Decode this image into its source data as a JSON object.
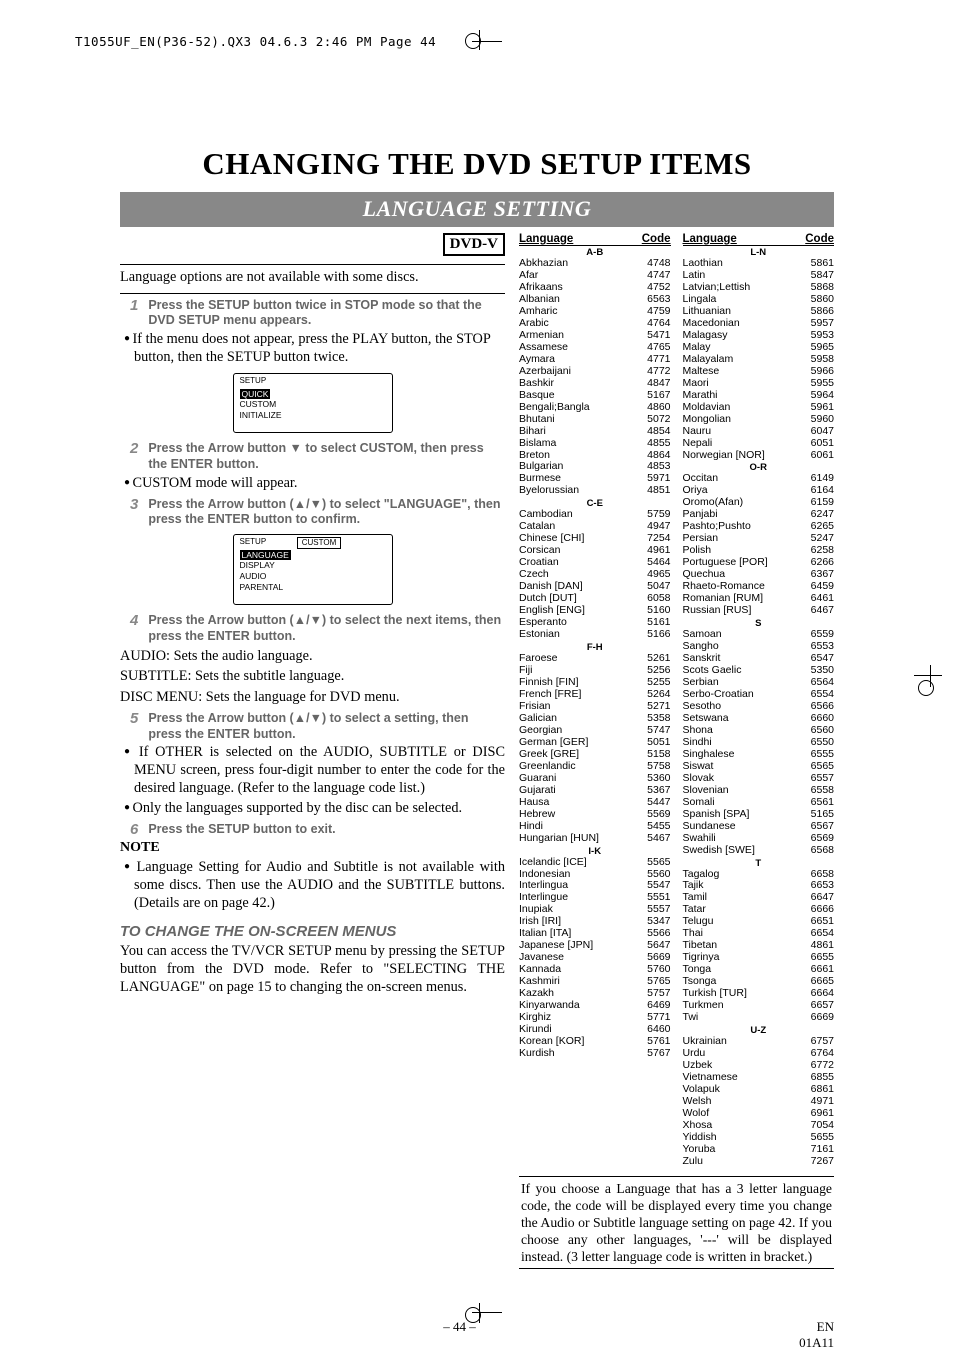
{
  "print_header": "T1055UF_EN(P36-52).QX3  04.6.3  2:46 PM  Page 44",
  "page_title": "CHANGING THE DVD SETUP ITEMS",
  "section_bar": "LANGUAGE SETTING",
  "dvd_box": "DVD-V",
  "intro": "Language options are not available with some discs.",
  "step1": "Press the SETUP button twice in STOP mode so that the DVD SETUP menu appears.",
  "bullet1": "If the menu does not appear, press the PLAY button, the STOP button, then the SETUP button twice.",
  "osd1": {
    "title": "SETUP",
    "items": [
      "QUICK",
      "CUSTOM",
      "INITIALIZE"
    ],
    "highlight": 0
  },
  "step2": "Press the Arrow button ▼ to select CUSTOM, then press the ENTER button.",
  "bullet2": "CUSTOM mode will appear.",
  "step3": "Press the Arrow button (▲/▼) to select \"LANGUAGE\", then press the ENTER button to confirm.",
  "osd2": {
    "title": "SETUP",
    "button": "CUSTOM",
    "items": [
      "LANGUAGE",
      "DISPLAY",
      "AUDIO",
      "PARENTAL"
    ],
    "highlight": 0
  },
  "step4": "Press the Arrow button (▲/▼) to select the next items, then press the ENTER button.",
  "descriptions": {
    "audio": "AUDIO: Sets the audio language.",
    "subtitle": "SUBTITLE: Sets the subtitle language.",
    "discmenu": "DISC MENU: Sets the language for DVD menu."
  },
  "step5": "Press the Arrow button (▲/▼) to select a setting, then press the ENTER button.",
  "bullet5a": "If OTHER is selected on the AUDIO, SUBTITLE or DISC MENU screen, press four-digit number to enter the code for the desired language. (Refer to the language code list.)",
  "bullet5b": "Only the languages supported by the disc can be selected.",
  "step6": "Press the SETUP button to exit.",
  "note_head": "NOTE",
  "note_bullet": "Language Setting for Audio and Subtitle is not available with some discs. Then use the AUDIO and the SUBTITLE buttons. (Details are on page 42.)",
  "subhead": "TO CHANGE THE ON-SCREEN MENUS",
  "subpara": "You can access the TV/VCR SETUP menu by pressing the SETUP button from the DVD mode. Refer to \"SELECTING THE LANGUAGE\" on page 15 to changing the on-screen menus.",
  "table_headers": {
    "lang": "Language",
    "code": "Code"
  },
  "groups_left": [
    {
      "head": "A-B",
      "items": [
        [
          "Abkhazian",
          "4748"
        ],
        [
          "Afar",
          "4747"
        ],
        [
          "Afrikaans",
          "4752"
        ],
        [
          "Albanian",
          "6563"
        ],
        [
          "Amharic",
          "4759"
        ],
        [
          "Arabic",
          "4764"
        ],
        [
          "Armenian",
          "5471"
        ],
        [
          "Assamese",
          "4765"
        ],
        [
          "Aymara",
          "4771"
        ],
        [
          "Azerbaijani",
          "4772"
        ],
        [
          "Bashkir",
          "4847"
        ],
        [
          "Basque",
          "5167"
        ],
        [
          "Bengali;Bangla",
          "4860"
        ],
        [
          "Bhutani",
          "5072"
        ],
        [
          "Bihari",
          "4854"
        ],
        [
          "Bislama",
          "4855"
        ],
        [
          "Breton",
          "4864"
        ],
        [
          "Bulgarian",
          "4853"
        ],
        [
          "Burmese",
          "5971"
        ],
        [
          "Byelorussian",
          "4851"
        ]
      ]
    },
    {
      "head": "C-E",
      "items": [
        [
          "Cambodian",
          "5759"
        ],
        [
          "Catalan",
          "4947"
        ],
        [
          "Chinese [CHI]",
          "7254"
        ],
        [
          "Corsican",
          "4961"
        ],
        [
          "Croatian",
          "5464"
        ],
        [
          "Czech",
          "4965"
        ],
        [
          "Danish [DAN]",
          "5047"
        ],
        [
          "Dutch [DUT]",
          "6058"
        ],
        [
          "English [ENG]",
          "5160"
        ],
        [
          "Esperanto",
          "5161"
        ],
        [
          "Estonian",
          "5166"
        ]
      ]
    },
    {
      "head": "F-H",
      "items": [
        [
          "Faroese",
          "5261"
        ],
        [
          "Fiji",
          "5256"
        ],
        [
          "Finnish [FIN]",
          "5255"
        ],
        [
          "French [FRE]",
          "5264"
        ],
        [
          "Frisian",
          "5271"
        ],
        [
          "Galician",
          "5358"
        ],
        [
          "Georgian",
          "5747"
        ],
        [
          "German [GER]",
          "5051"
        ],
        [
          "Greek [GRE]",
          "5158"
        ],
        [
          "Greenlandic",
          "5758"
        ],
        [
          "Guarani",
          "5360"
        ],
        [
          "Gujarati",
          "5367"
        ],
        [
          "Hausa",
          "5447"
        ],
        [
          "Hebrew",
          "5569"
        ],
        [
          "Hindi",
          "5455"
        ],
        [
          "Hungarian [HUN]",
          "5467"
        ]
      ]
    },
    {
      "head": "I-K",
      "items": [
        [
          "Icelandic [ICE]",
          "5565"
        ],
        [
          "Indonesian",
          "5560"
        ],
        [
          "Interlingua",
          "5547"
        ],
        [
          "Interlingue",
          "5551"
        ],
        [
          "Inupiak",
          "5557"
        ],
        [
          "Irish [IRI]",
          "5347"
        ],
        [
          "Italian [ITA]",
          "5566"
        ],
        [
          "Japanese [JPN]",
          "5647"
        ],
        [
          "Javanese",
          "5669"
        ],
        [
          "Kannada",
          "5760"
        ],
        [
          "Kashmiri",
          "5765"
        ],
        [
          "Kazakh",
          "5757"
        ],
        [
          "Kinyarwanda",
          "6469"
        ],
        [
          "Kirghiz",
          "5771"
        ],
        [
          "Kirundi",
          "6460"
        ],
        [
          "Korean [KOR]",
          "5761"
        ],
        [
          "Kurdish",
          "5767"
        ]
      ]
    }
  ],
  "groups_right": [
    {
      "head": "L-N",
      "items": [
        [
          "Laothian",
          "5861"
        ],
        [
          "Latin",
          "5847"
        ],
        [
          "Latvian;Lettish",
          "5868"
        ],
        [
          "Lingala",
          "5860"
        ],
        [
          "Lithuanian",
          "5866"
        ],
        [
          "Macedonian",
          "5957"
        ],
        [
          "Malagasy",
          "5953"
        ],
        [
          "Malay",
          "5965"
        ],
        [
          "Malayalam",
          "5958"
        ],
        [
          "Maltese",
          "5966"
        ],
        [
          "Maori",
          "5955"
        ],
        [
          "Marathi",
          "5964"
        ],
        [
          "Moldavian",
          "5961"
        ],
        [
          "Mongolian",
          "5960"
        ],
        [
          "Nauru",
          "6047"
        ],
        [
          "Nepali",
          "6051"
        ],
        [
          "Norwegian [NOR]",
          "6061"
        ]
      ]
    },
    {
      "head": "O-R",
      "items": [
        [
          "Occitan",
          "6149"
        ],
        [
          "Oriya",
          "6164"
        ],
        [
          "Oromo(Afan)",
          "6159"
        ],
        [
          "Panjabi",
          "6247"
        ],
        [
          "Pashto;Pushto",
          "6265"
        ],
        [
          "Persian",
          "5247"
        ],
        [
          "Polish",
          "6258"
        ],
        [
          "Portuguese [POR]",
          "6266"
        ],
        [
          "Quechua",
          "6367"
        ],
        [
          "Rhaeto-Romance",
          "6459"
        ],
        [
          "Romanian [RUM]",
          "6461"
        ],
        [
          "Russian [RUS]",
          "6467"
        ]
      ]
    },
    {
      "head": "S",
      "items": [
        [
          "Samoan",
          "6559"
        ],
        [
          "Sangho",
          "6553"
        ],
        [
          "Sanskrit",
          "6547"
        ],
        [
          "Scots Gaelic",
          "5350"
        ],
        [
          "Serbian",
          "6564"
        ],
        [
          "Serbo-Croatian",
          "6554"
        ],
        [
          "Sesotho",
          "6566"
        ],
        [
          "Setswana",
          "6660"
        ],
        [
          "Shona",
          "6560"
        ],
        [
          "Sindhi",
          "6550"
        ],
        [
          "Singhalese",
          "6555"
        ],
        [
          "Siswat",
          "6565"
        ],
        [
          "Slovak",
          "6557"
        ],
        [
          "Slovenian",
          "6558"
        ],
        [
          "Somali",
          "6561"
        ],
        [
          "Spanish [SPA]",
          "5165"
        ],
        [
          "Sundanese",
          "6567"
        ],
        [
          "Swahili",
          "6569"
        ],
        [
          "Swedish [SWE]",
          "6568"
        ]
      ]
    },
    {
      "head": "T",
      "items": [
        [
          "Tagalog",
          "6658"
        ],
        [
          "Tajik",
          "6653"
        ],
        [
          "Tamil",
          "6647"
        ],
        [
          "Tatar",
          "6666"
        ],
        [
          "Telugu",
          "6651"
        ],
        [
          "Thai",
          "6654"
        ],
        [
          "Tibetan",
          "4861"
        ],
        [
          "Tigrinya",
          "6655"
        ],
        [
          "Tonga",
          "6661"
        ],
        [
          "Tsonga",
          "6665"
        ],
        [
          "Turkish [TUR]",
          "6664"
        ],
        [
          "Turkmen",
          "6657"
        ],
        [
          "Twi",
          "6669"
        ]
      ]
    },
    {
      "head": "U-Z",
      "items": [
        [
          "Ukrainian",
          "6757"
        ],
        [
          "Urdu",
          "6764"
        ],
        [
          "Uzbek",
          "6772"
        ],
        [
          "Vietnamese",
          "6855"
        ],
        [
          "Volapuk",
          "6861"
        ],
        [
          "Welsh",
          "4971"
        ],
        [
          "Wolof",
          "6961"
        ],
        [
          "Xhosa",
          "7054"
        ],
        [
          "Yiddish",
          "5655"
        ],
        [
          "Yoruba",
          "7161"
        ],
        [
          "Zulu",
          "7267"
        ]
      ]
    }
  ],
  "bottom_note": "If you choose a Language that has a 3 letter language code, the code will be displayed every time you change the Audio or Subtitle language setting on page 42. If you choose any other languages, '---' will be displayed instead. (3 letter language code is written in bracket.)",
  "footer": {
    "center": "– 44 –",
    "right1": "EN",
    "right2": "01A11"
  }
}
